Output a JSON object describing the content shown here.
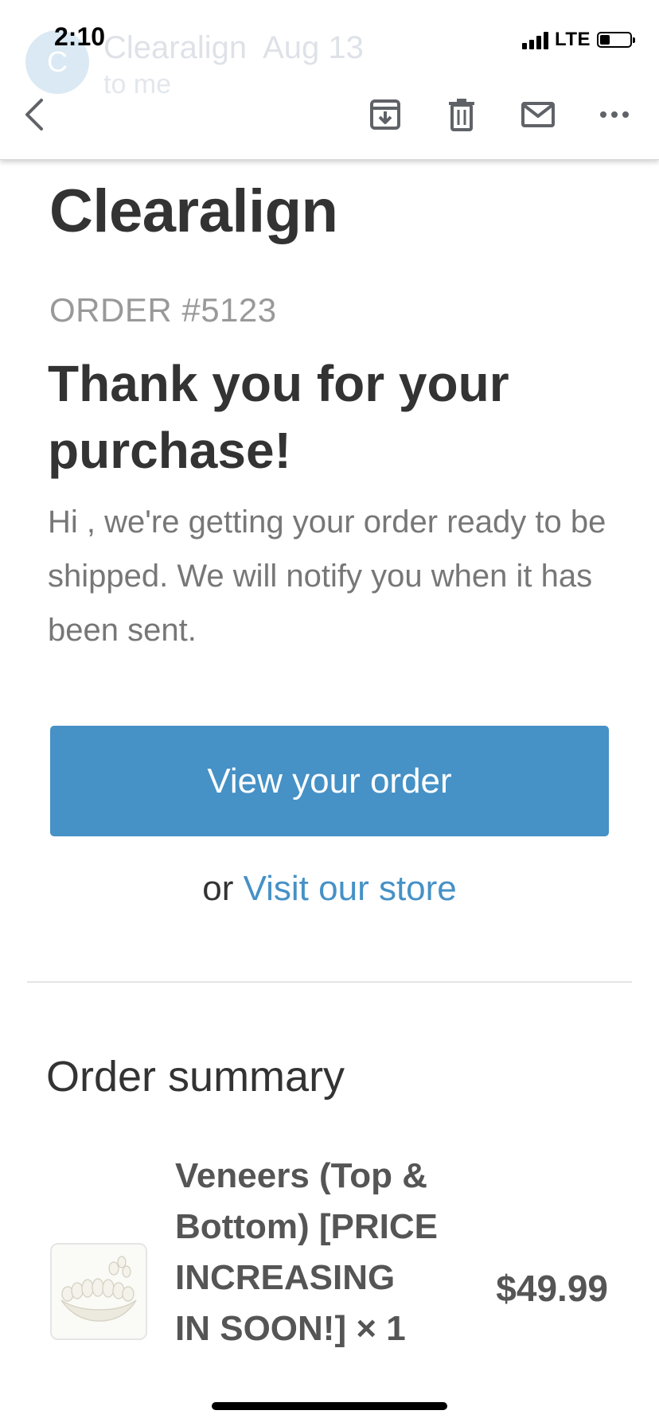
{
  "status_bar": {
    "time": "2:10",
    "network": "LTE"
  },
  "header": {
    "sender_initial": "C",
    "sender_name": "Clearalign",
    "date": "Aug 13",
    "recipient": "to me"
  },
  "toolbar": {
    "icons": [
      "back-icon",
      "archive-icon",
      "trash-icon",
      "mail-icon",
      "more-icon"
    ]
  },
  "email": {
    "store_name": "Clearalign",
    "order_number": "ORDER #5123",
    "thank_you": "Thank you for your purchase!",
    "message": "Hi , we're getting your order ready to be shipped. We will notify you when it has been sent.",
    "view_order_button": "View your order",
    "or_text": "or",
    "visit_store_link": "Visit our store",
    "order_summary_heading": "Order summary",
    "items": [
      {
        "title": "Veneers (Top & Bottom) [PRICE INCREASING IN SOON!] × 1",
        "price": "$49.99"
      }
    ]
  },
  "colors": {
    "accent": "#4691c6",
    "text_dark": "#333333",
    "text_muted": "#999999"
  }
}
